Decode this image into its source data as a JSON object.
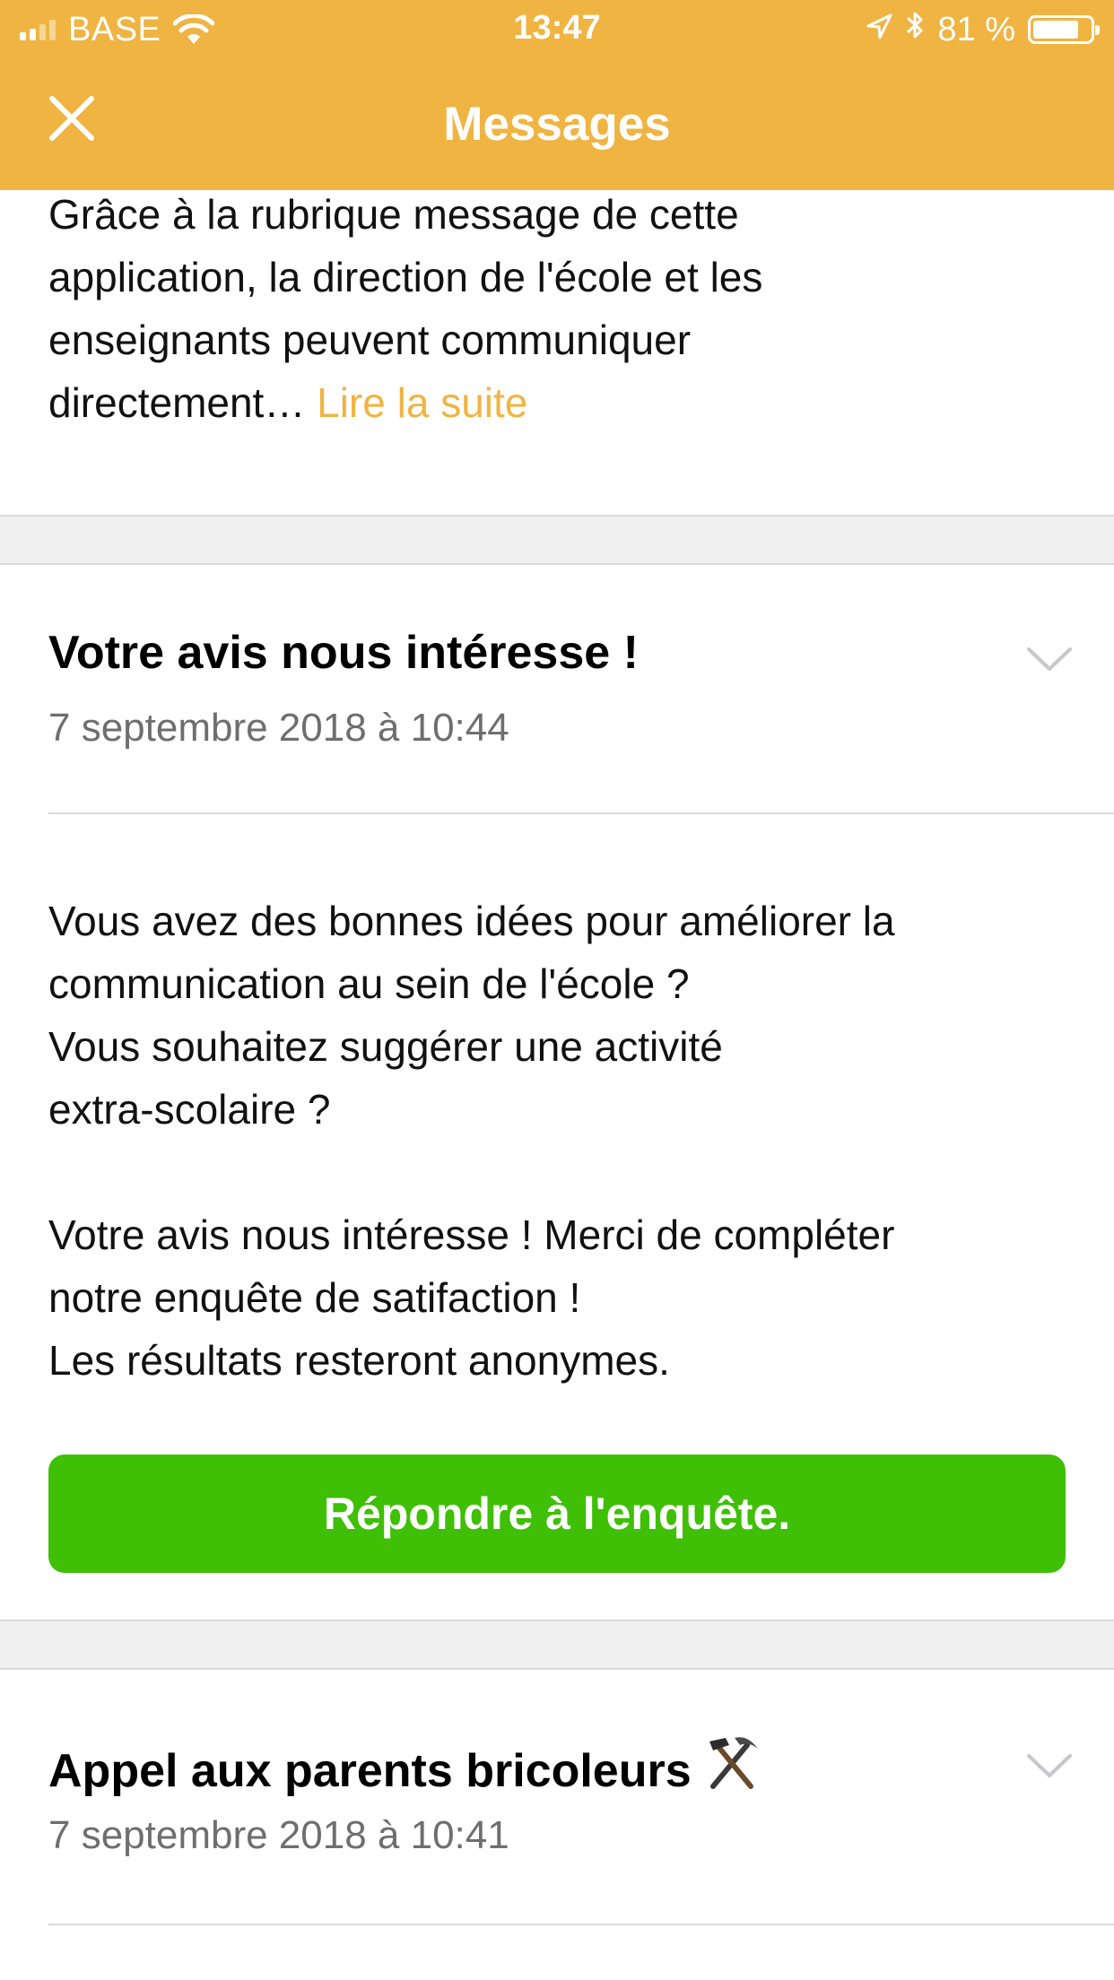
{
  "status_bar": {
    "carrier": "BASE",
    "time": "13:47",
    "battery_text": "81 %",
    "battery_level": 0.81,
    "signal_bars_total": 4,
    "signal_bars_filled": 2
  },
  "nav": {
    "title": "Messages",
    "close_icon": "close-icon"
  },
  "messages": [
    {
      "body": "Grâce à la rubrique message de cette\napplication, la direction de l'école et les\nenseignants peuvent communiquer\ndirectement… ",
      "read_more": "Lire la suite"
    },
    {
      "title": "Votre avis nous intéresse !",
      "date": "7 septembre 2018 à 10:44",
      "body": "Vous avez des bonnes idées pour améliorer la\ncommunication au sein de l'école ?\nVous souhaitez suggérer une activité\nextra-scolaire ?\n\nVotre avis nous intéresse ! Merci de compléter\nnotre enquête de satifaction !\nLes résultats resteront anonymes.",
      "cta_label": "Répondre à l'enquête.",
      "expanded": true
    },
    {
      "title": "Appel aux parents bricoleurs",
      "title_icon": "hammer-and-pick-icon",
      "date": "7 septembre 2018 à 10:41",
      "expanded": false
    }
  ],
  "colors": {
    "brand": "#EFB442",
    "cta": "#3FBF05",
    "separator": "#F0F0F0",
    "muted_text": "#6E6E6E"
  }
}
